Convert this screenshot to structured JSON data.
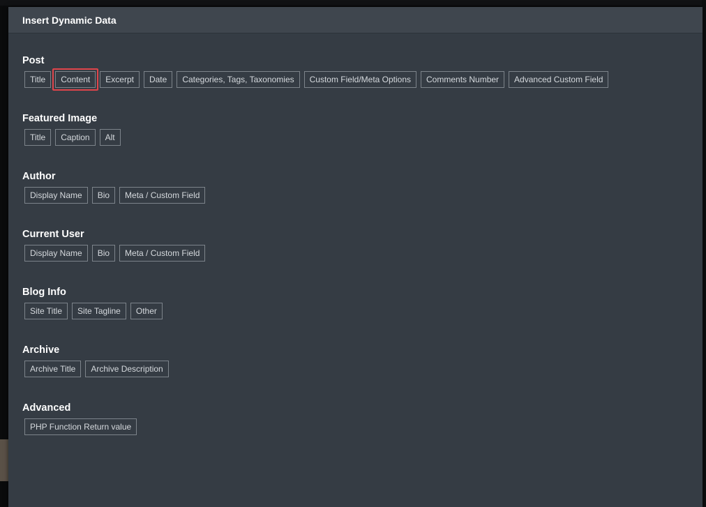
{
  "modal": {
    "title": "Insert Dynamic Data"
  },
  "groups": [
    {
      "title": "Post",
      "items": [
        "Title",
        "Content",
        "Excerpt",
        "Date",
        "Categories, Tags, Taxonomies",
        "Custom Field/Meta Options",
        "Comments Number",
        "Advanced Custom Field"
      ]
    },
    {
      "title": "Featured Image",
      "items": [
        "Title",
        "Caption",
        "Alt"
      ]
    },
    {
      "title": "Author",
      "items": [
        "Display Name",
        "Bio",
        "Meta / Custom Field"
      ]
    },
    {
      "title": "Current User",
      "items": [
        "Display Name",
        "Bio",
        "Meta / Custom Field"
      ]
    },
    {
      "title": "Blog Info",
      "items": [
        "Site Title",
        "Site Tagline",
        "Other"
      ]
    },
    {
      "title": "Archive",
      "items": [
        "Archive Title",
        "Archive Description"
      ]
    },
    {
      "title": "Advanced",
      "items": [
        "PHP Function Return value"
      ]
    }
  ],
  "colors": {
    "modal_bg": "#353c44",
    "header_bg": "#3f464e",
    "chip_border": "#7d848b",
    "highlight": "#e0454b"
  }
}
